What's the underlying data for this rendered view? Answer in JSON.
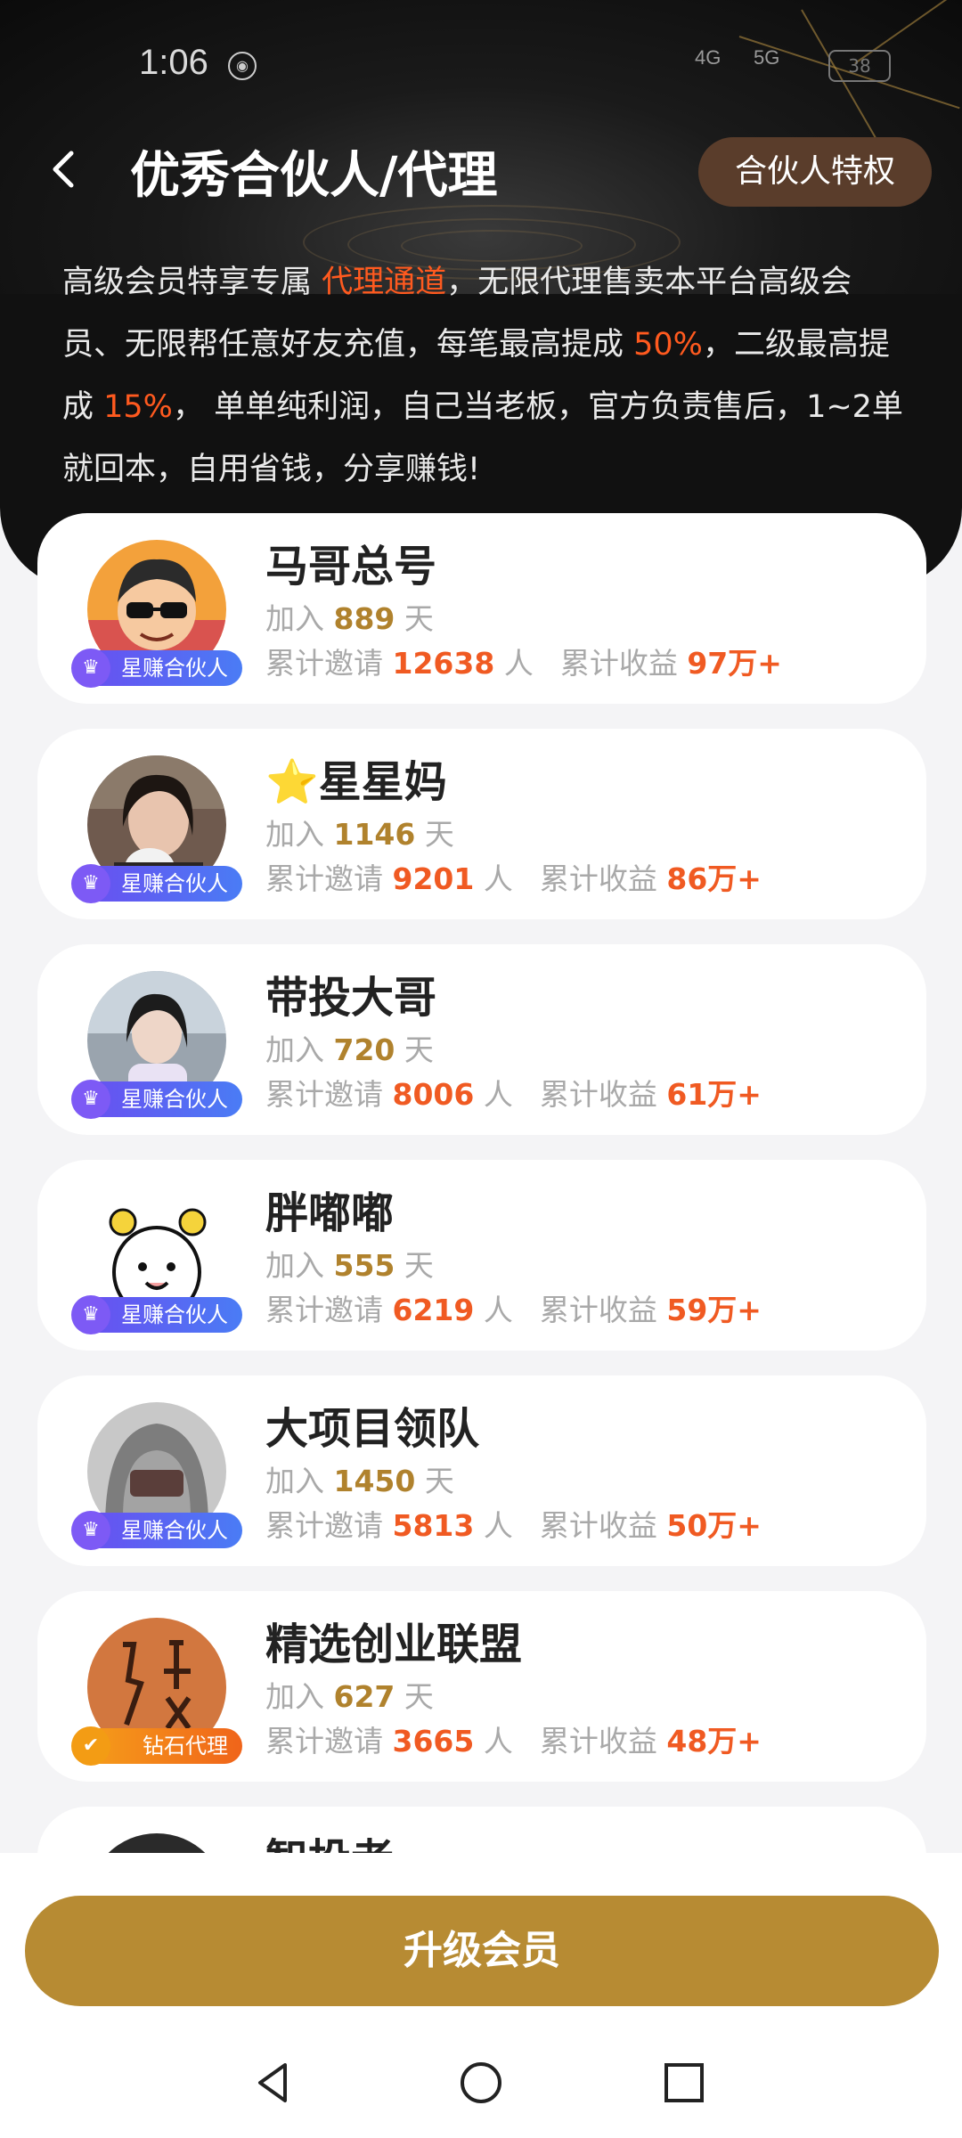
{
  "status_bar": {
    "time": "1:06",
    "network1": "4G",
    "network2": "5G",
    "battery": "38"
  },
  "header": {
    "title": "优秀合伙人/代理",
    "privilege_button": "合伙人特权"
  },
  "description": {
    "p1": "高级会员特享专属 ",
    "h1": "代理通道",
    "p2": "，无限代理售卖本平台高级会员、无限帮任意好友充值，每笔最高提成 ",
    "h2": "50%",
    "p3": "，二级最高提成 ",
    "h3": "15%",
    "p4": "， 单单纯利润，自己当老板，官方负责售后，1~2单就回本，自用省钱，分享赚钱!"
  },
  "labels": {
    "join_prefix": "加入",
    "join_suffix": "天",
    "invite_prefix": "累计邀请",
    "invite_suffix": "人",
    "income_prefix": "累计收益"
  },
  "partners": [
    {
      "name": "马哥总号",
      "days": "889",
      "invites": "12638",
      "income": "97万+",
      "badge": "星赚合伙人"
    },
    {
      "name": "⭐星星妈",
      "days": "1146",
      "invites": "9201",
      "income": "86万+",
      "badge": "星赚合伙人"
    },
    {
      "name": "带投大哥",
      "days": "720",
      "invites": "8006",
      "income": "61万+",
      "badge": "星赚合伙人"
    },
    {
      "name": "胖嘟嘟",
      "days": "555",
      "invites": "6219",
      "income": "59万+",
      "badge": "星赚合伙人"
    },
    {
      "name": "大项目领队",
      "days": "1450",
      "invites": "5813",
      "income": "50万+",
      "badge": "星赚合伙人"
    },
    {
      "name": "精选创业联盟",
      "days": "627",
      "invites": "3665",
      "income": "48万+",
      "badge": "钻石代理"
    },
    {
      "name": "智投者"
    }
  ],
  "upgrade_button": "升级会员",
  "colors": {
    "accent_gold": "#b78b33",
    "highlight_orange": "#f05a22",
    "badge_purple": "#6b4cf0",
    "badge_orange": "#f39c14"
  }
}
